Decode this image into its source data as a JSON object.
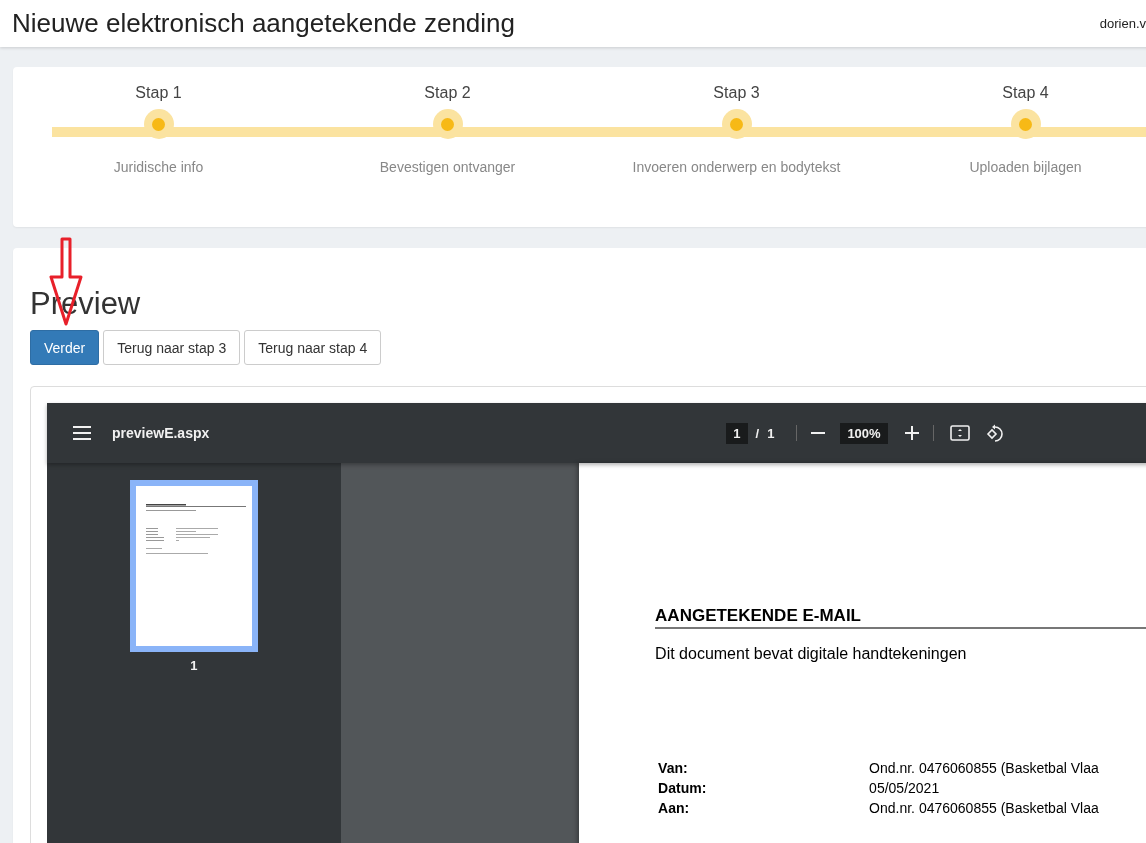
{
  "header": {
    "title": "Nieuwe elektronisch aangetekende zending",
    "user": "dorien.v"
  },
  "steps": [
    {
      "number": "Stap 1",
      "label": "Juridische info"
    },
    {
      "number": "Stap 2",
      "label": "Bevestigen ontvanger"
    },
    {
      "number": "Stap 3",
      "label": "Invoeren onderwerp en bodytekst"
    },
    {
      "number": "Stap 4",
      "label": "Uploaden bijlagen"
    }
  ],
  "preview": {
    "heading": "Preview",
    "buttons": [
      {
        "label": "Verder",
        "kind": "primary"
      },
      {
        "label": "Terug naar stap 3",
        "kind": "default"
      },
      {
        "label": "Terug naar stap 4",
        "kind": "default"
      }
    ],
    "viewer": {
      "filename": "previewE.aspx",
      "page": "1",
      "separator": "/",
      "page_count": "1",
      "zoom": "100%",
      "thumbnail_label": "1",
      "document": {
        "title": "AANGETEKENDE E-MAIL",
        "subtitle": "Dit document bevat digitale handtekeningen",
        "rows": [
          {
            "label": "Van:",
            "value": "Ond.nr. 0476060855 (Basketbal Vlaa"
          },
          {
            "label": "Datum:",
            "value": "05/05/2021"
          },
          {
            "label": "Aan:",
            "value": "Ond.nr. 0476060855 (Basketbal Vlaa"
          }
        ]
      }
    }
  }
}
